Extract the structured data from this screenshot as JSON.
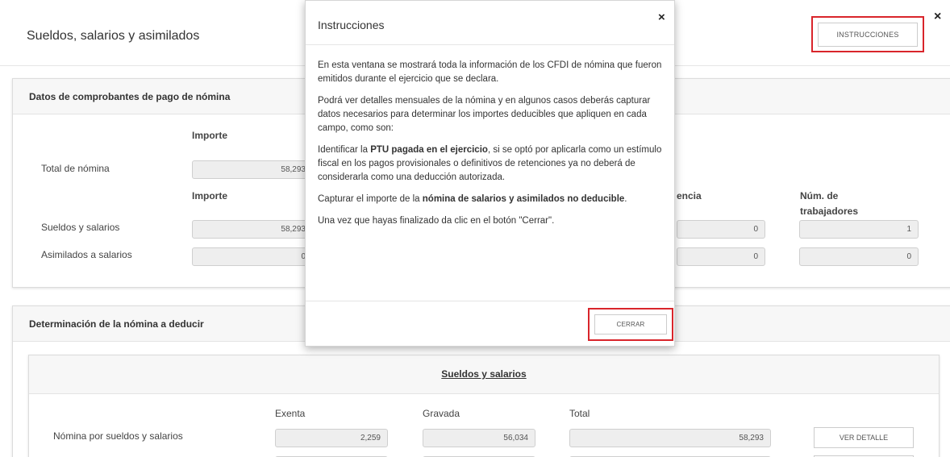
{
  "header": {
    "title": "Sueldos, salarios y asimilados",
    "instructions_button": "INSTRUCCIONES",
    "close_icon": "×"
  },
  "panel1": {
    "title": "Datos de comprobantes de pago de nómina",
    "col_importe": "Importe",
    "total_label": "Total de nómina",
    "total_value": "58,293",
    "col_importe2": "Importe",
    "col_partial": "encia",
    "col_trabajadores_1": "Núm. de",
    "col_trabajadores_2": "trabajadores",
    "rows": [
      {
        "label": "Sueldos y salarios",
        "importe": "58,293",
        "col3": "0",
        "trabajadores": "1"
      },
      {
        "label": "Asimilados a salarios",
        "importe": "0",
        "col3": "0",
        "trabajadores": "0"
      }
    ]
  },
  "panel2": {
    "title": "Determinación de la nómina a deducir",
    "subpanel_title": "Sueldos y salarios",
    "col_exenta": "Exenta",
    "col_gravada": "Gravada",
    "col_total": "Total",
    "row_label": "Nómina por sueldos y salarios",
    "exenta": "2,259",
    "gravada": "56,034",
    "total": "58,293",
    "detail_button": "VER DETALLE"
  },
  "modal": {
    "title": "Instrucciones",
    "close_icon": "×",
    "p1": "En esta ventana se mostrará toda la información de los CFDI de nómina que fueron emitidos durante el ejercicio que se declara.",
    "p2": "Podrá ver detalles mensuales de la nómina y en algunos casos deberás capturar datos necesarios para determinar los importes deducibles que apliquen en cada campo, como son:",
    "p3_a": "Identificar la ",
    "p3_b": "PTU pagada en el ejercicio",
    "p3_c": ", si se optó por aplicarla como un estímulo fiscal en los pagos provisionales o definitivos de retenciones ya no deberá de considerarla como una deducción autorizada.",
    "p4_a": "Capturar el importe de la ",
    "p4_b": "nómina de salarios y asimilados no deducible",
    "p4_c": ".",
    "p5": "Una vez que hayas finalizado da clic en el botón \"Cerrar\".",
    "close_button": "CERRAR"
  },
  "colors": {
    "highlight": "#d9252b",
    "field_bg": "#eeeeee"
  }
}
